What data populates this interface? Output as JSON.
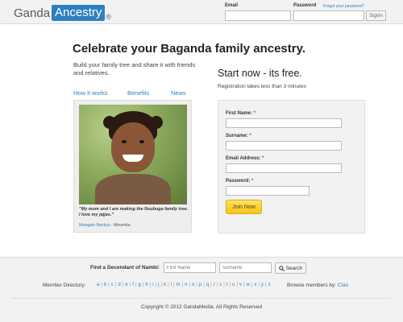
{
  "header": {
    "logo_part1": "Ganda",
    "logo_part2": "Ancestry",
    "logo_reg": "®",
    "email_label": "Email",
    "password_label": "Password",
    "forgot_link": "Forgot your password?",
    "email_value": "",
    "password_value": "",
    "signin_label": "Signin"
  },
  "hero": {
    "headline": "Celebrate your Baganda family ancestry.",
    "subline": "Build your family tree and share it with friends and relatives.",
    "tabs": [
      "How it works",
      "Benefits",
      "News"
    ],
    "quote": "\"My mom and I are making the Nsubuga family tree. I love my jajjas.\"",
    "credit_name": "Mwagale Nankya",
    "credit_sep": " - ",
    "credit_place": "Mmamba"
  },
  "signup": {
    "title": "Start now - its free.",
    "note": "Registration takes less than 3 minutes",
    "fields": [
      {
        "label": "First Name:",
        "required_mark": "*",
        "value": ""
      },
      {
        "label": "Surname:",
        "required_mark": "*",
        "value": ""
      },
      {
        "label": "Email Address:",
        "required_mark": "*",
        "value": ""
      },
      {
        "label": "Password:",
        "required_mark": "*",
        "value": ""
      }
    ],
    "join_label": "Join Now"
  },
  "footer": {
    "find_label": "Find a Decendant of Nambi:",
    "first_name_placeholder": "First Name",
    "surname_placeholder": "Surname",
    "search_label": "Search",
    "directory_label": "Member Directory:",
    "letters": [
      "a",
      "b",
      "c",
      "d",
      "e",
      "f",
      "g",
      "h",
      "i",
      "j",
      "k",
      "l",
      "m",
      "n",
      "o",
      "p",
      "q",
      "r",
      "s",
      "t",
      "u",
      "v",
      "w",
      "x",
      "y",
      "z"
    ],
    "browse_label": "Browse members by:",
    "browse_link": "Clan",
    "copyright": "Copyright © 2012 GandaMedia. All Rights Reserved"
  },
  "colors": {
    "brand_blue": "#2f7fc0",
    "join_yellow": "#f5c418",
    "required_red": "#c0392b"
  },
  "icons": {
    "search": "magnifier-icon"
  }
}
